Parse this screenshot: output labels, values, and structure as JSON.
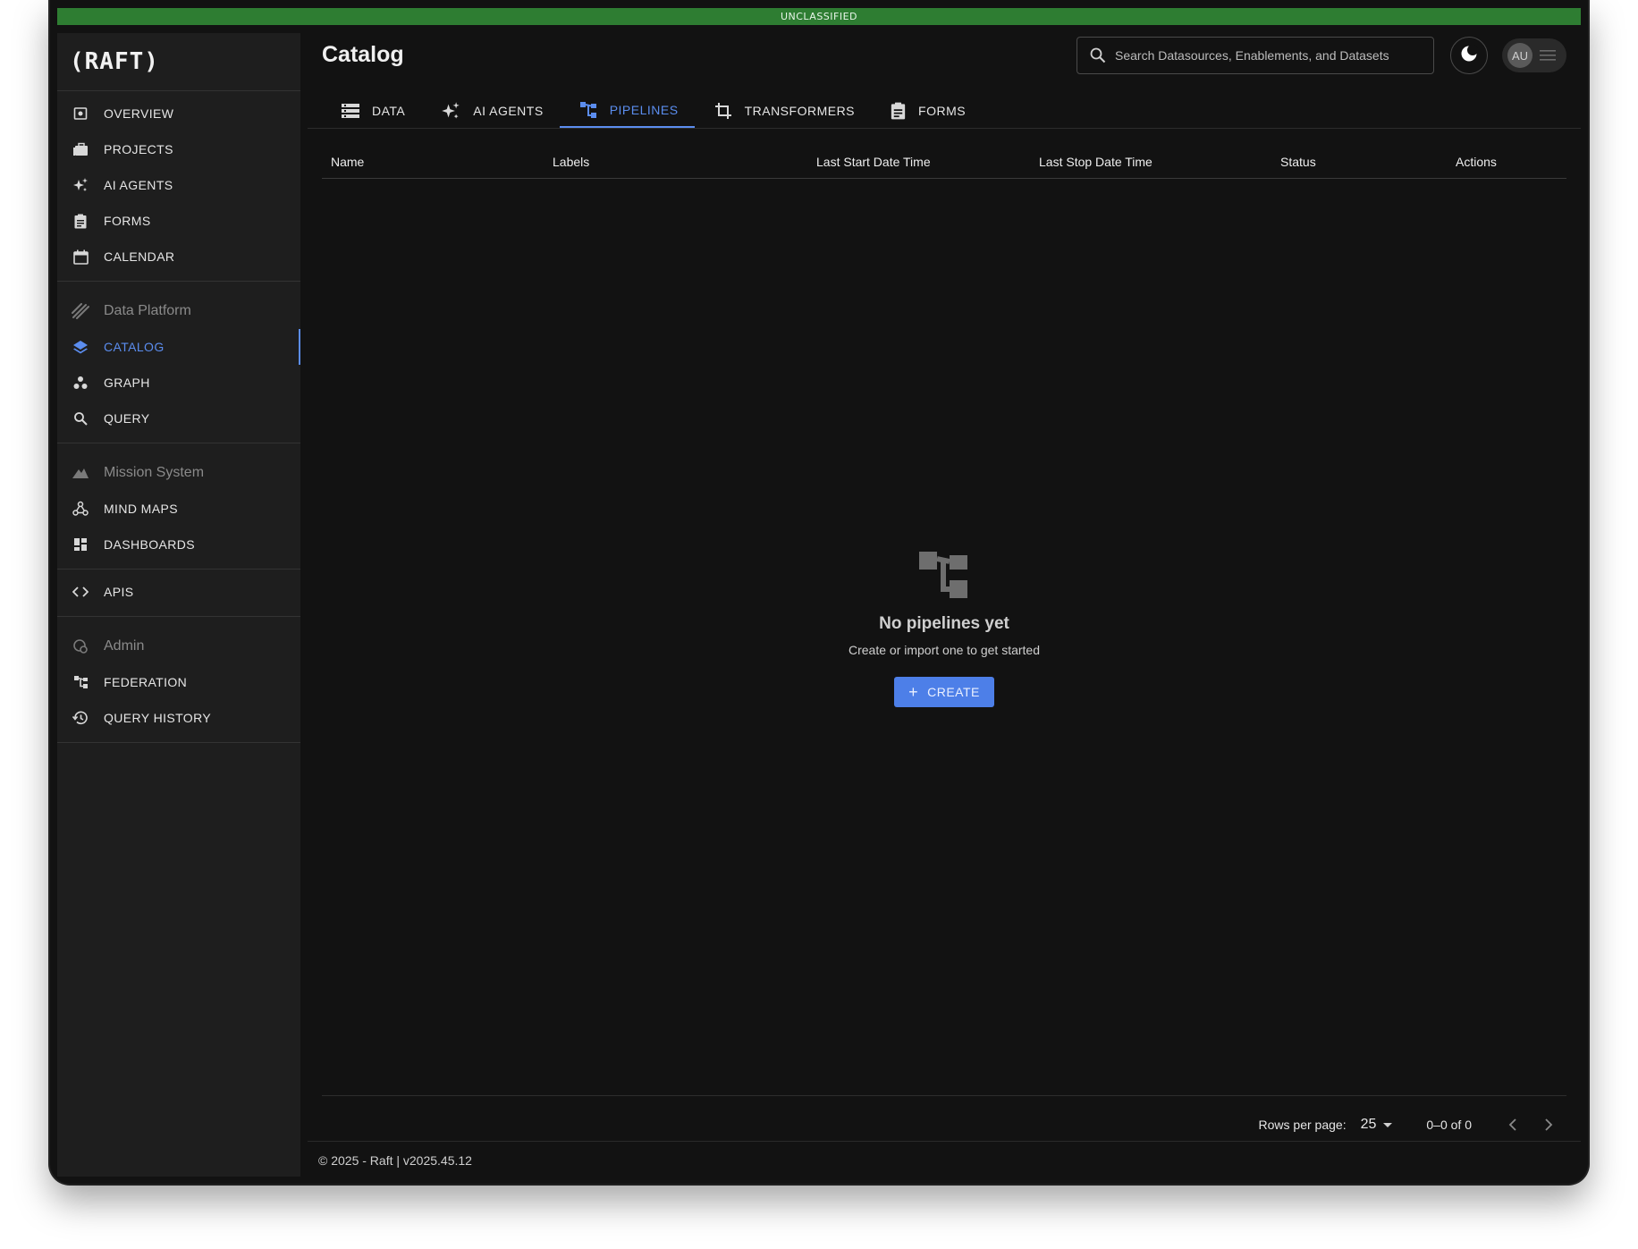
{
  "classification": "UNCLASSIFIED",
  "app": {
    "logo": "(RAFT)"
  },
  "sidebar": {
    "main_items": [
      {
        "label": "OVERVIEW",
        "icon": "overview-icon"
      },
      {
        "label": "PROJECTS",
        "icon": "briefcase-icon"
      },
      {
        "label": "AI AGENTS",
        "icon": "sparkle-icon"
      },
      {
        "label": "FORMS",
        "icon": "clipboard-icon"
      },
      {
        "label": "CALENDAR",
        "icon": "calendar-icon"
      }
    ],
    "data_platform": {
      "heading": "Data Platform",
      "items": [
        {
          "label": "CATALOG",
          "icon": "layers-icon",
          "active": true
        },
        {
          "label": "GRAPH",
          "icon": "graph-icon"
        },
        {
          "label": "QUERY",
          "icon": "search-icon"
        }
      ]
    },
    "mission_system": {
      "heading": "Mission System",
      "items": [
        {
          "label": "MIND MAPS",
          "icon": "webhook-icon"
        },
        {
          "label": "DASHBOARDS",
          "icon": "dashboard-icon"
        }
      ]
    },
    "apis": {
      "label": "APIS",
      "icon": "code-icon"
    },
    "admin": {
      "heading": "Admin",
      "items": [
        {
          "label": "FEDERATION",
          "icon": "federation-icon"
        },
        {
          "label": "QUERY HISTORY",
          "icon": "history-icon"
        }
      ]
    }
  },
  "header": {
    "title": "Catalog",
    "search_placeholder": "Search Datasources, Enablements, and Datasets",
    "user_initials": "AU"
  },
  "tabs": [
    {
      "label": "DATA",
      "icon": "list-icon"
    },
    {
      "label": "AI AGENTS",
      "icon": "sparkle-icon"
    },
    {
      "label": "PIPELINES",
      "icon": "pipeline-icon",
      "active": true
    },
    {
      "label": "TRANSFORMERS",
      "icon": "crop-icon"
    },
    {
      "label": "FORMS",
      "icon": "clipboard-icon"
    }
  ],
  "table": {
    "columns": [
      "Name",
      "Labels",
      "Last Start Date Time",
      "Last Stop Date Time",
      "Status",
      "Actions"
    ],
    "rows": []
  },
  "empty_state": {
    "title": "No pipelines yet",
    "subtitle": "Create or import one to get started",
    "button": "CREATE"
  },
  "pagination": {
    "rows_per_page_label": "Rows per page:",
    "rows_per_page": "25",
    "range": "0–0 of 0"
  },
  "footer": {
    "text": "© 2025 - Raft  | v2025.45.12"
  },
  "colors": {
    "accent": "#5b8def",
    "classification": "#2e7d32",
    "background": "#121212",
    "sidebar": "#1e1e1e"
  }
}
